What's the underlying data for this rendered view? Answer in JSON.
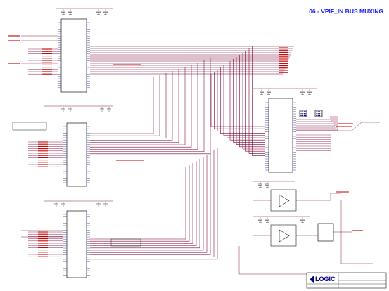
{
  "sheet": {
    "title": "06 - VPIF_IN BUS MUXING",
    "colors": {
      "wire": "#8b1a4b",
      "bus": "#7a0033",
      "component": "#1a1a1a",
      "chip_fill": "#ffffff",
      "label": "#c00000",
      "title": "#1a1aff",
      "pin": "#000080",
      "background": "#ffffff"
    }
  },
  "title_block": {
    "company": "LOGIC"
  }
}
